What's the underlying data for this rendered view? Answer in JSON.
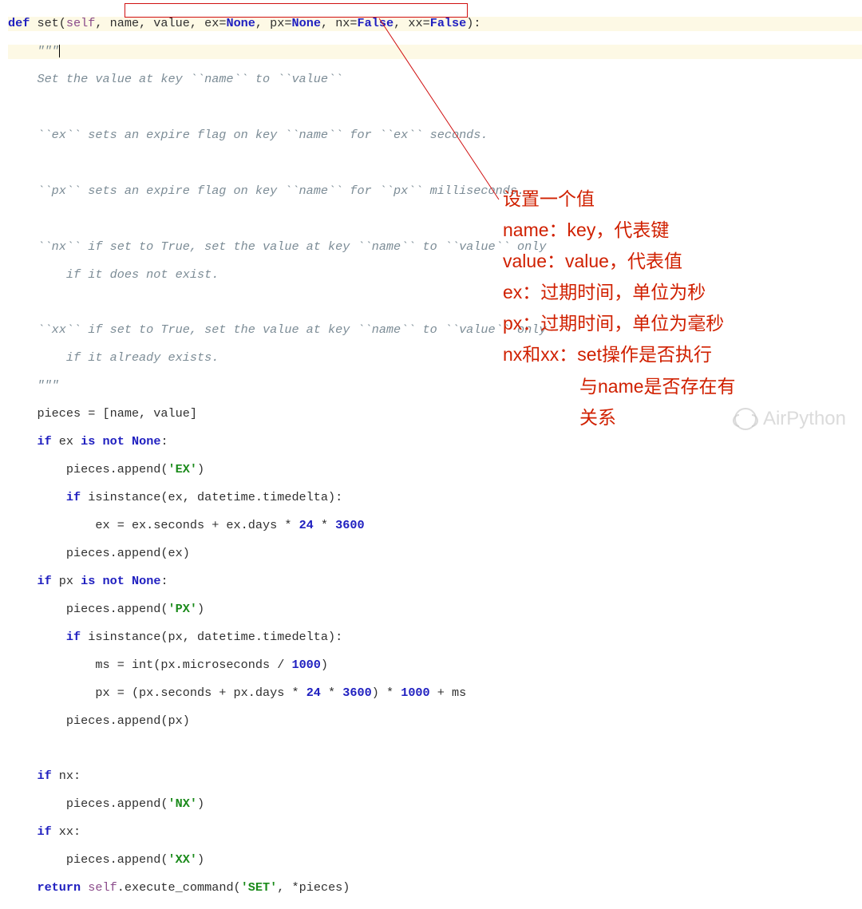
{
  "code": {
    "l1_def": "def",
    "l1_a": " set(",
    "l1_self": "self",
    "l1_b": ", name, value, ex=",
    "l1_none1": "None",
    "l1_c": ", px=",
    "l1_none2": "None",
    "l1_d": ", nx=",
    "l1_false1": "False",
    "l1_e": ", xx=",
    "l1_false2": "False",
    "l1_f": "):",
    "l2": "    \"\"\"",
    "l3": "    Set the value at key ``name`` to ``value``",
    "l4": "",
    "l5": "    ``ex`` sets an expire flag on key ``name`` for ``ex`` seconds.",
    "l6": "",
    "l7": "    ``px`` sets an expire flag on key ``name`` for ``px`` milliseconds.",
    "l8": "",
    "l9": "    ``nx`` if set to True, set the value at key ``name`` to ``value`` only",
    "l10": "        if it does not exist.",
    "l11": "",
    "l12": "    ``xx`` if set to True, set the value at key ``name`` to ``value`` only",
    "l13": "        if it already exists.",
    "l14": "    \"\"\"",
    "l15": "    pieces = [name, value]",
    "l16_if": "    if",
    "l16_a": " ex ",
    "l16_is": "is",
    "l16_b": " ",
    "l16_not": "not",
    "l16_c": " ",
    "l16_none": "None",
    "l16_d": ":",
    "l17_a": "        pieces.append(",
    "l17_str": "'EX'",
    "l17_b": ")",
    "l18_if": "        if",
    "l18_a": " isinstance(ex, datetime.timedelta):",
    "l19_a": "            ex = ex.seconds + ex.days * ",
    "l19_n1": "24",
    "l19_b": " * ",
    "l19_n2": "3600",
    "l20": "        pieces.append(ex)",
    "l21_if": "    if",
    "l21_a": " px ",
    "l21_is": "is",
    "l21_b": " ",
    "l21_not": "not",
    "l21_c": " ",
    "l21_none": "None",
    "l21_d": ":",
    "l22_a": "        pieces.append(",
    "l22_str": "'PX'",
    "l22_b": ")",
    "l23_if": "        if",
    "l23_a": " isinstance(px, datetime.timedelta):",
    "l24_a": "            ms = int(px.microseconds / ",
    "l24_n1": "1000",
    "l24_b": ")",
    "l25_a": "            px = (px.seconds + px.days * ",
    "l25_n1": "24",
    "l25_b": " * ",
    "l25_n2": "3600",
    "l25_c": ") * ",
    "l25_n3": "1000",
    "l25_d": " + ms",
    "l26": "        pieces.append(px)",
    "l27": "",
    "l28_if": "    if",
    "l28_a": " nx:",
    "l29_a": "        pieces.append(",
    "l29_str": "'NX'",
    "l29_b": ")",
    "l30_if": "    if",
    "l30_a": " xx:",
    "l31_a": "        pieces.append(",
    "l31_str": "'XX'",
    "l31_b": ")",
    "l32_ret": "    return",
    "l32_a": " ",
    "l32_self": "self",
    "l32_b": ".execute_command(",
    "l32_str": "'SET'",
    "l32_c": ", *pieces)"
  },
  "annotation": {
    "l1": "设置一个值",
    "l2": "name：key，代表键",
    "l3": "value：value，代表值",
    "l4": "ex：过期时间，单位为秒",
    "l5": "px：过期时间，单位为毫秒",
    "l6": "nx和xx：set操作是否执行",
    "l7": "与name是否存在有",
    "l8": "关系"
  },
  "watermark": "AirPython"
}
